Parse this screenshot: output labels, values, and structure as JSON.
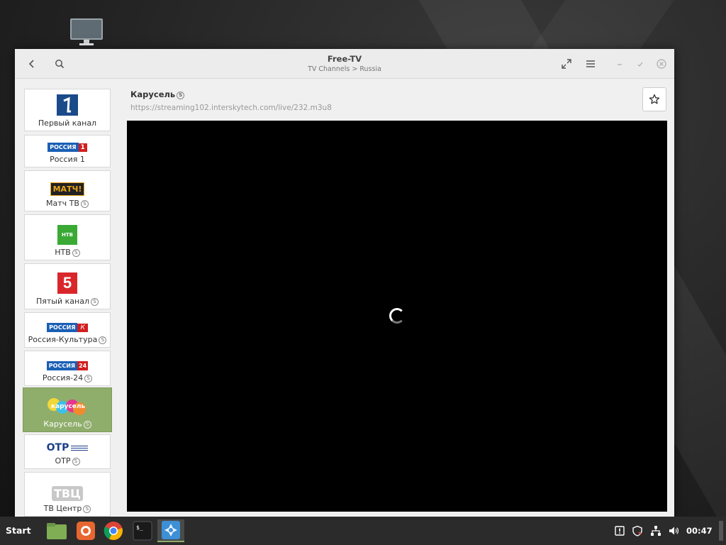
{
  "window": {
    "title": "Free-TV",
    "subtitle": "TV Channels > Russia"
  },
  "channels": [
    {
      "name": "Первый канал",
      "logo": "1",
      "suffix": ""
    },
    {
      "name": "Россия 1",
      "logo": "РОССИЯ",
      "logo_badge": "1",
      "suffix": ""
    },
    {
      "name": "Матч ТВ",
      "logo": "МАТЧ!",
      "suffix": "S"
    },
    {
      "name": "НТВ",
      "logo": "НТВ",
      "suffix": "S"
    },
    {
      "name": "Пятый канал",
      "logo": "5",
      "suffix": "S"
    },
    {
      "name": "Россия-Культура",
      "logo": "РОССИЯ",
      "logo_badge": "К",
      "suffix": "S"
    },
    {
      "name": "Россия-24",
      "logo": "РОССИЯ",
      "logo_badge": "24",
      "suffix": "S"
    },
    {
      "name": "Карусель",
      "logo": "карусель",
      "suffix": "S",
      "selected": true
    },
    {
      "name": "ОТР",
      "logo": "ОТР",
      "suffix": "S"
    },
    {
      "name": "ТВ Центр",
      "logo": "ТВЦ",
      "suffix": "S"
    }
  ],
  "main": {
    "channel_title": "Карусель",
    "channel_suffix": "S",
    "stream_url": "https://streaming102.interskytech.com/live/232.m3u8"
  },
  "taskbar": {
    "start_label": "Start",
    "clock": "00:47",
    "apps": [
      "files-icon",
      "firefox-icon",
      "chrome-icon",
      "terminal-icon",
      "freetv-icon"
    ],
    "tray": [
      "update-icon",
      "shield-icon",
      "network-icon",
      "volume-icon"
    ]
  },
  "colors": {
    "selected": "#8fae6b",
    "player_bg": "#000000",
    "taskbar_bg": "#2b2b2b"
  }
}
